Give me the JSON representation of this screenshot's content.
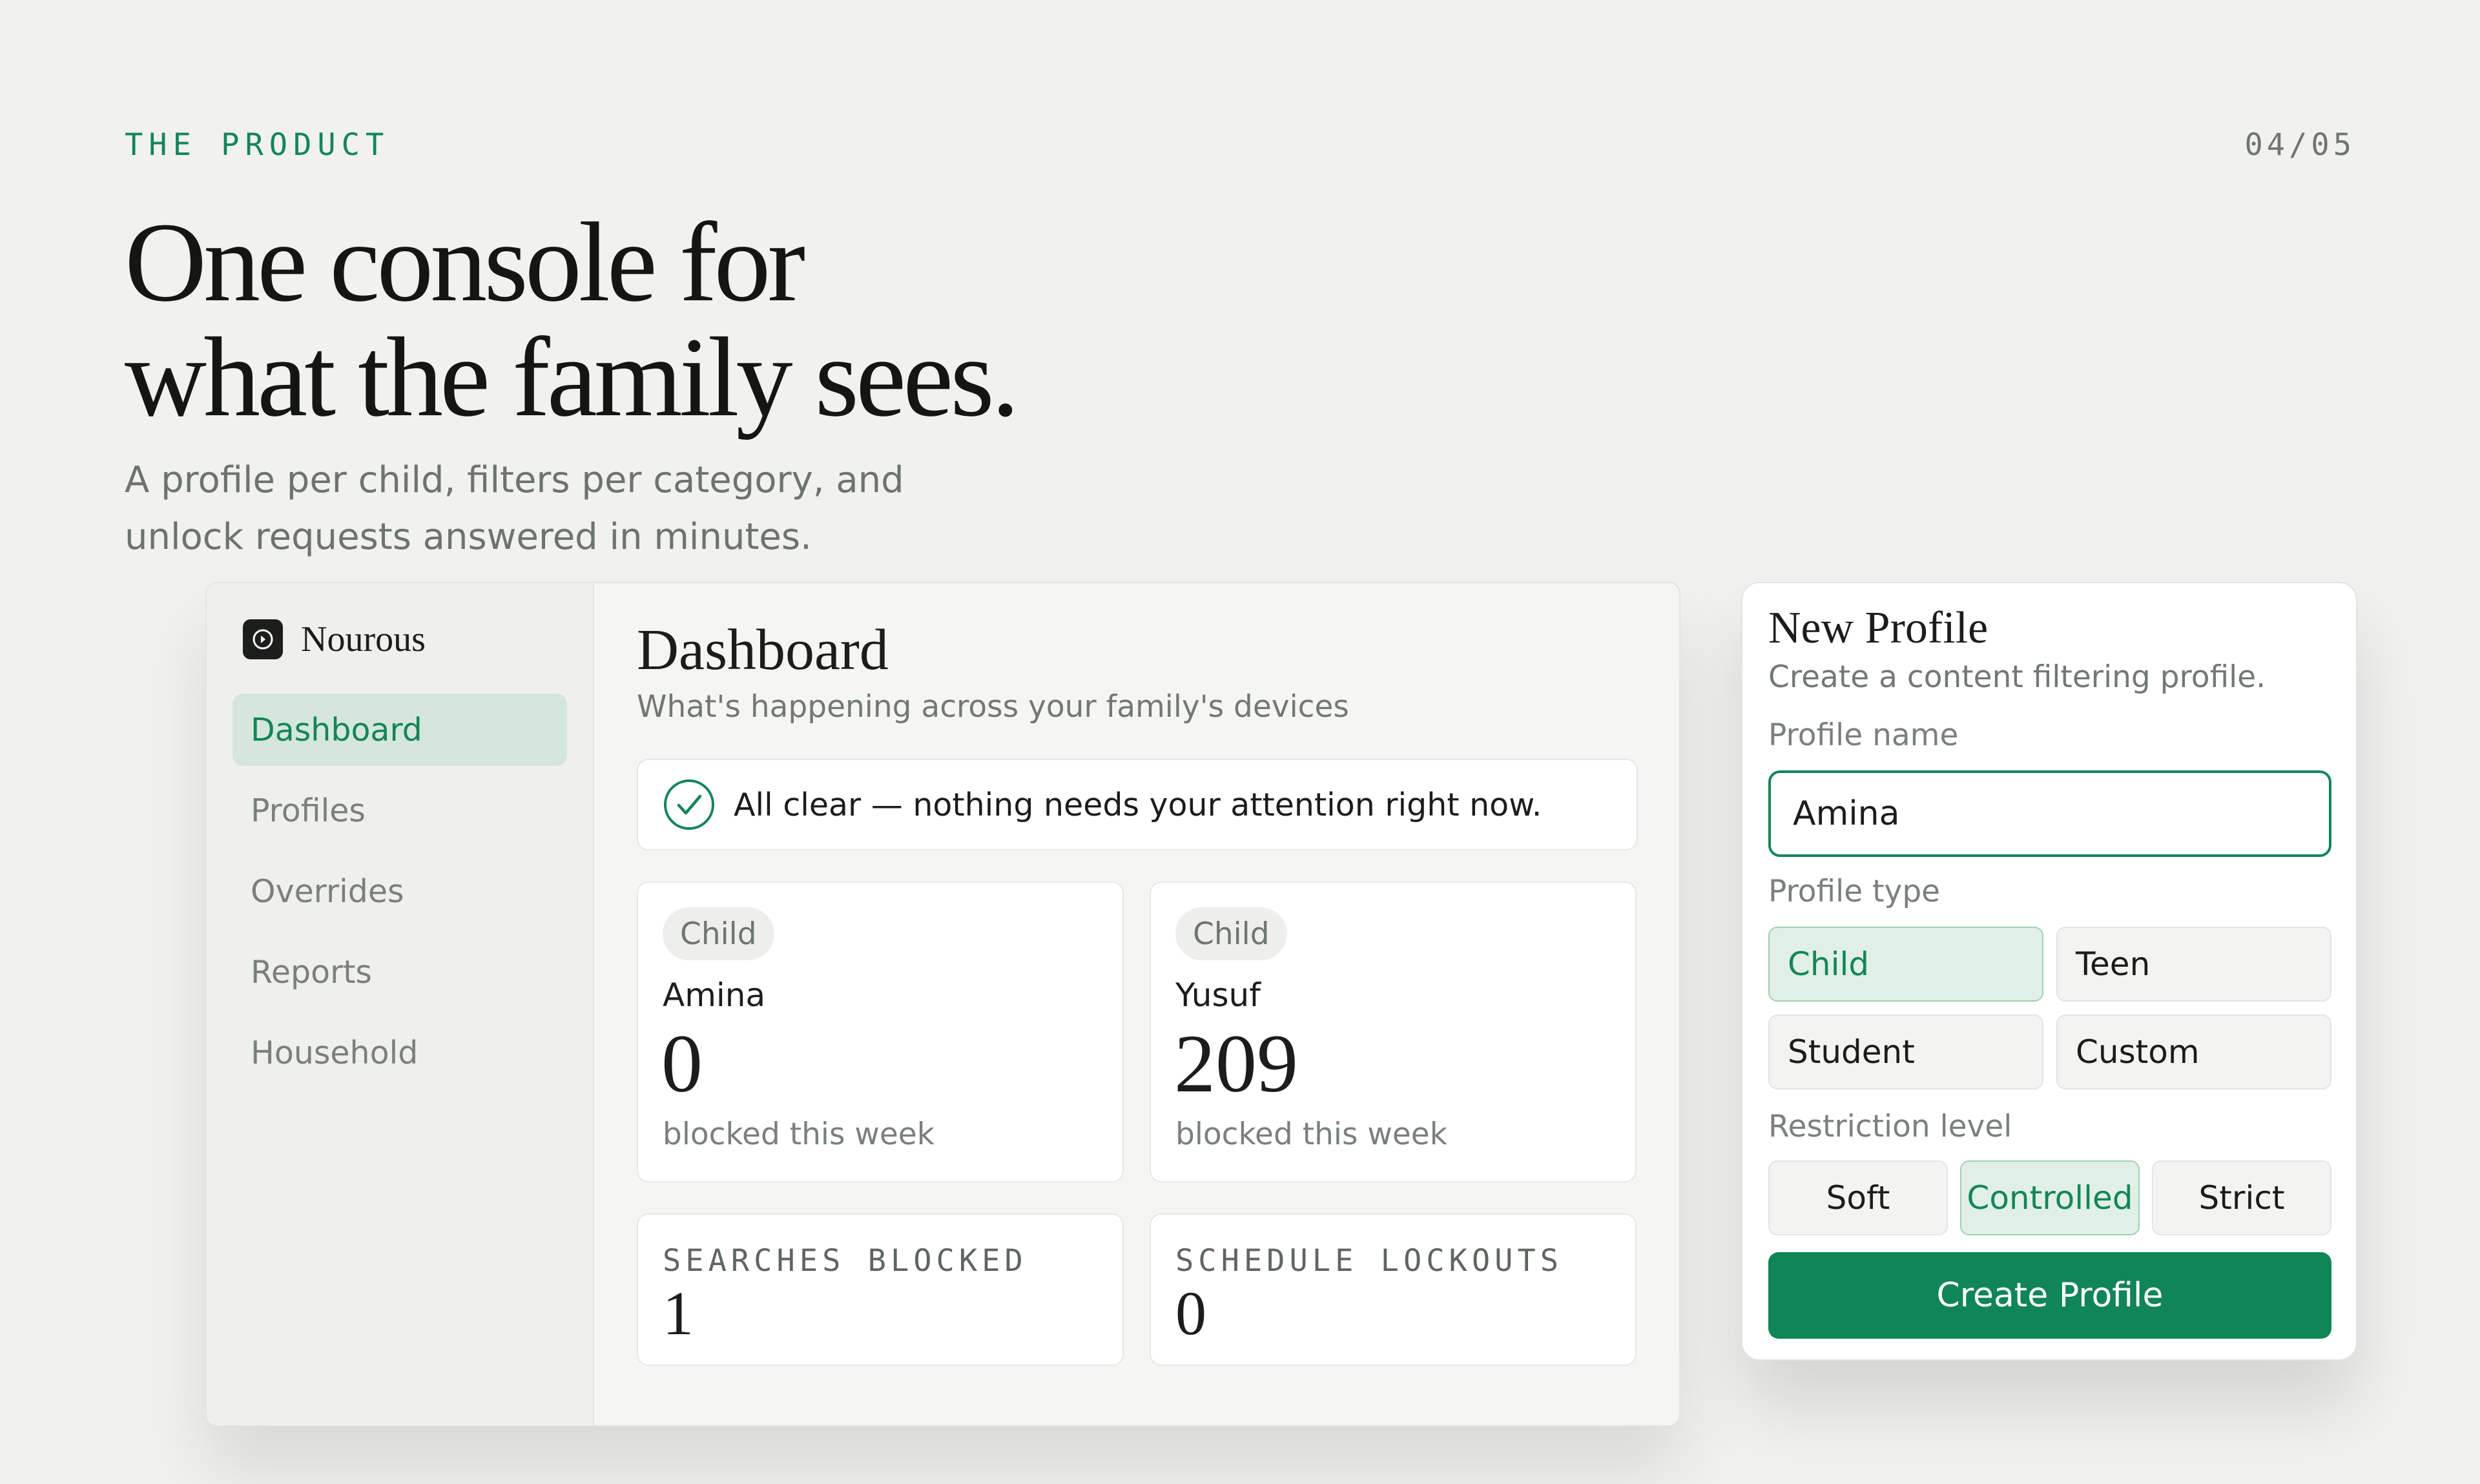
{
  "header": {
    "eyebrow": "THE PRODUCT",
    "page_number": "04/05",
    "headline_line1": "One console for",
    "headline_line2": "what the family sees.",
    "subhead_line1": "A profile per child, filters per category, and",
    "subhead_line2": "unlock requests answered in minutes."
  },
  "console": {
    "brand": "Nourous",
    "nav": [
      {
        "label": "Dashboard",
        "active": true
      },
      {
        "label": "Profiles",
        "active": false
      },
      {
        "label": "Overrides",
        "active": false
      },
      {
        "label": "Reports",
        "active": false
      },
      {
        "label": "Household",
        "active": false
      }
    ],
    "title": "Dashboard",
    "subtitle": "What's happening across your family's devices",
    "alert": "All clear — nothing needs your attention right now.",
    "children": [
      {
        "badge": "Child",
        "name": "Amina",
        "count": "0",
        "caption": "blocked this week"
      },
      {
        "badge": "Child",
        "name": "Yusuf",
        "count": "209",
        "caption": "blocked this week"
      }
    ],
    "stats": [
      {
        "label": "SEARCHES BLOCKED",
        "value": "1"
      },
      {
        "label": "SCHEDULE LOCKOUTS",
        "value": "0"
      }
    ]
  },
  "new_profile": {
    "title": "New Profile",
    "subtitle": "Create a content filtering profile.",
    "name_label": "Profile name",
    "name_value": "Amina",
    "type_label": "Profile type",
    "types": [
      "Child",
      "Teen",
      "Student",
      "Custom"
    ],
    "selected_type": "Child",
    "level_label": "Restriction level",
    "levels": [
      "Soft",
      "Controlled",
      "Strict"
    ],
    "selected_level": "Controlled",
    "create_label": "Create Profile"
  },
  "colors": {
    "accent": "#138558",
    "background": "#f1f2ef",
    "button": "#108557"
  }
}
